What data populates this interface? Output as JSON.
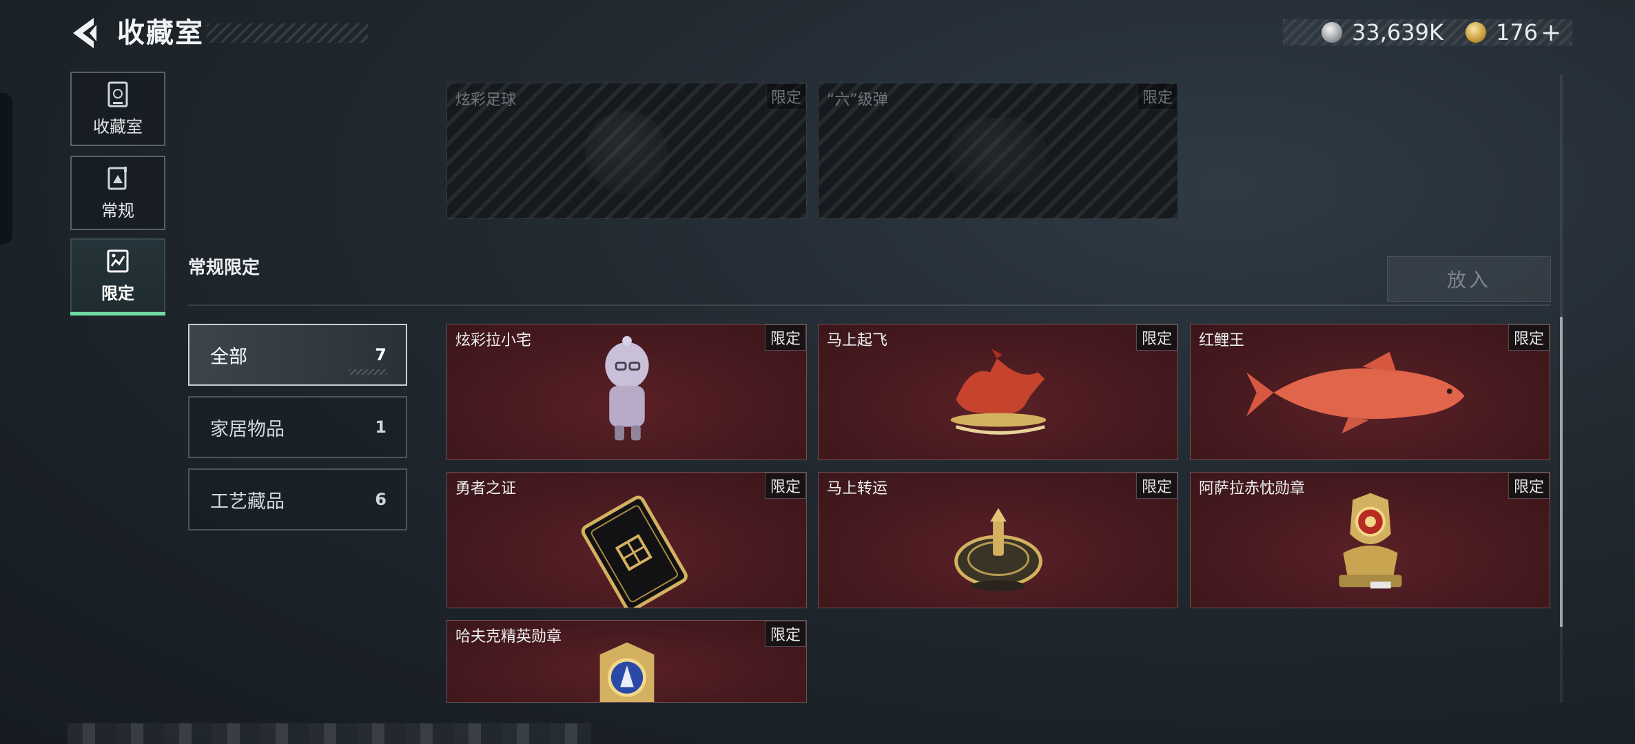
{
  "header": {
    "title": "收藏室",
    "currencies": [
      {
        "icon": "silver-coin-icon",
        "value": "33,639K"
      },
      {
        "icon": "gold-coin-icon",
        "value": "176",
        "plus": "+"
      }
    ]
  },
  "sidebar": {
    "tabs": [
      {
        "label": "收藏室",
        "icon": "collection-room-icon",
        "active": false
      },
      {
        "label": "常规",
        "icon": "regular-icon",
        "active": false
      },
      {
        "label": "限定",
        "icon": "limited-icon",
        "active": true
      }
    ]
  },
  "locked_items": [
    {
      "name": "炫彩足球",
      "tag": "限定"
    },
    {
      "name": "“六”级弹",
      "tag": "限定"
    }
  ],
  "section": {
    "title": "常规限定",
    "put_button": "放入"
  },
  "filters": [
    {
      "label": "全部",
      "count": "7",
      "active": true
    },
    {
      "label": "家居物品",
      "count": "1",
      "active": false
    },
    {
      "label": "工艺藏品",
      "count": "6",
      "active": false
    }
  ],
  "items": [
    {
      "name": "炫彩拉小宅",
      "tag": "限定",
      "icon": "figurine-icon"
    },
    {
      "name": "马上起飞",
      "tag": "限定",
      "icon": "horse-statue-icon"
    },
    {
      "name": "红鲤王",
      "tag": "限定",
      "icon": "carp-icon"
    },
    {
      "name": "勇者之证",
      "tag": "限定",
      "icon": "card-icon"
    },
    {
      "name": "马上转运",
      "tag": "限定",
      "icon": "spinner-plate-icon"
    },
    {
      "name": "阿萨拉赤忱勋章",
      "tag": "限定",
      "icon": "medal-icon"
    },
    {
      "name": "哈夫克精英勋章",
      "tag": "限定",
      "icon": "badge-icon"
    }
  ],
  "colors": {
    "accent": "#6fdca0",
    "card_bg": "#4a1b20",
    "background": "#1f272e"
  }
}
